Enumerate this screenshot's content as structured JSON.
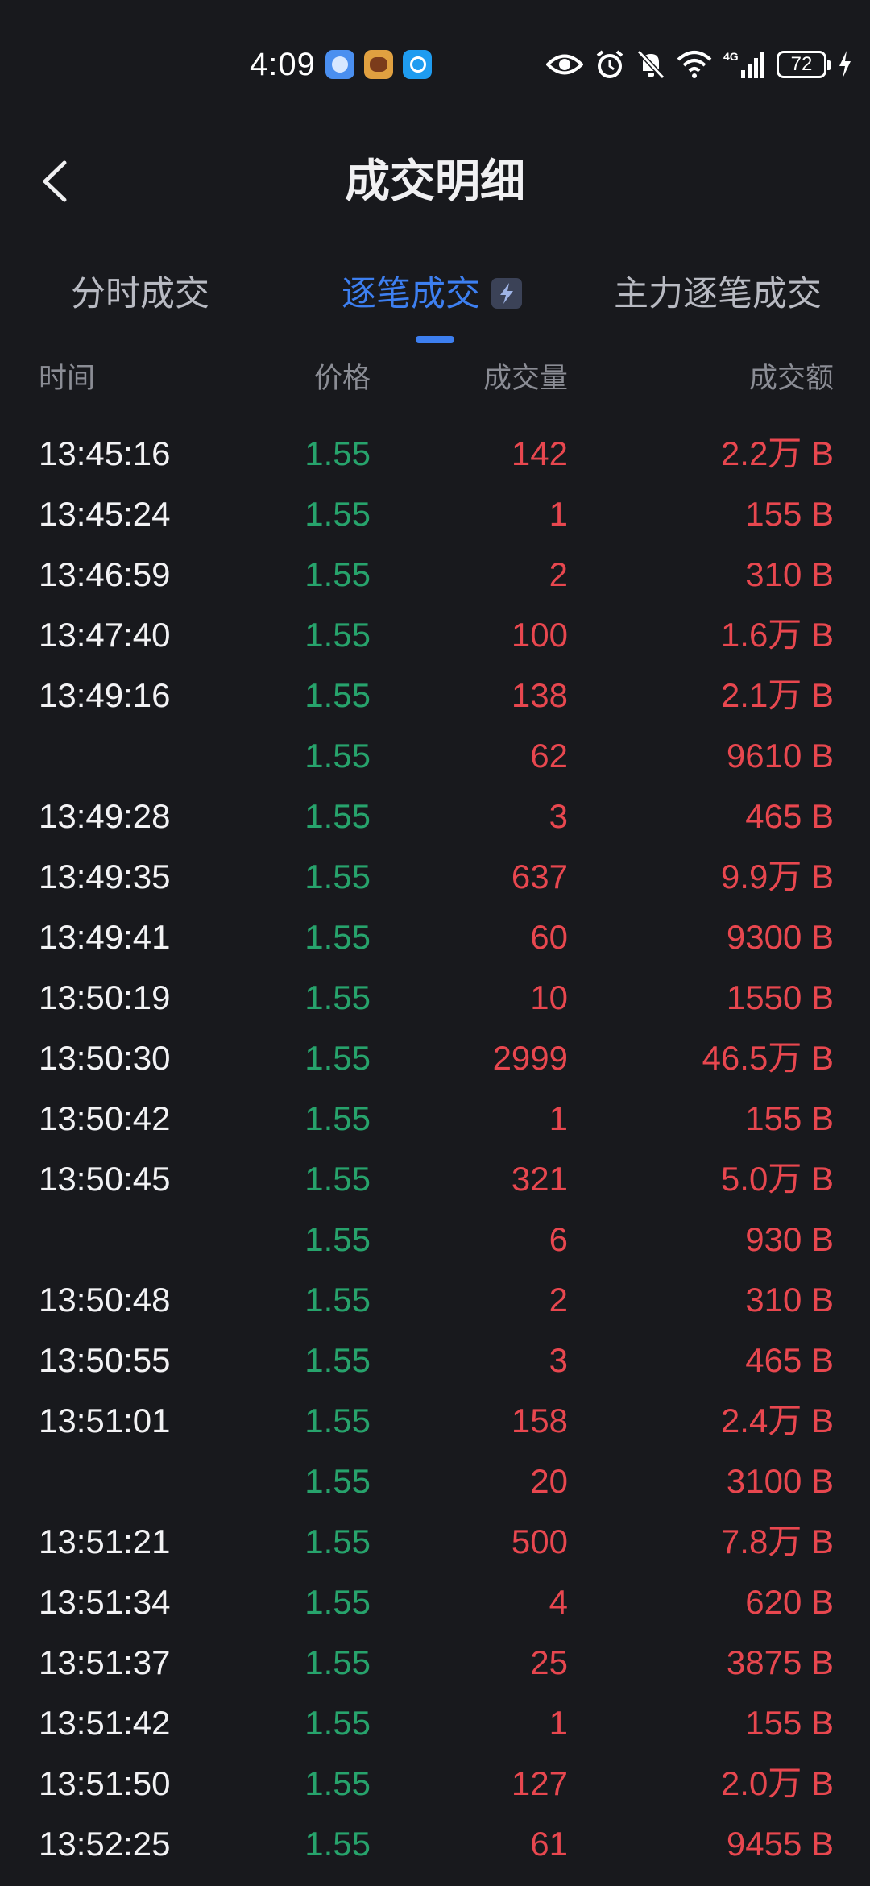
{
  "status_bar": {
    "time": "4:09",
    "battery": "72",
    "network": "4G"
  },
  "header": {
    "title": "成交明细"
  },
  "tabs": [
    {
      "label": "分时成交"
    },
    {
      "label": "逐笔成交"
    },
    {
      "label": "主力逐笔成交"
    }
  ],
  "active_tab": "逐笔成交",
  "columns": {
    "time": "时间",
    "price": "价格",
    "volume": "成交量",
    "amount": "成交额"
  },
  "trades": [
    {
      "time": "13:45:16",
      "price": "1.55",
      "volume": "142",
      "amount": "2.2万 B"
    },
    {
      "time": "13:45:24",
      "price": "1.55",
      "volume": "1",
      "amount": "155 B"
    },
    {
      "time": "13:46:59",
      "price": "1.55",
      "volume": "2",
      "amount": "310 B"
    },
    {
      "time": "13:47:40",
      "price": "1.55",
      "volume": "100",
      "amount": "1.6万 B"
    },
    {
      "time": "13:49:16",
      "price": "1.55",
      "volume": "138",
      "amount": "2.1万 B"
    },
    {
      "time": "",
      "price": "1.55",
      "volume": "62",
      "amount": "9610 B"
    },
    {
      "time": "13:49:28",
      "price": "1.55",
      "volume": "3",
      "amount": "465 B"
    },
    {
      "time": "13:49:35",
      "price": "1.55",
      "volume": "637",
      "amount": "9.9万 B"
    },
    {
      "time": "13:49:41",
      "price": "1.55",
      "volume": "60",
      "amount": "9300 B"
    },
    {
      "time": "13:50:19",
      "price": "1.55",
      "volume": "10",
      "amount": "1550 B"
    },
    {
      "time": "13:50:30",
      "price": "1.55",
      "volume": "2999",
      "amount": "46.5万 B"
    },
    {
      "time": "13:50:42",
      "price": "1.55",
      "volume": "1",
      "amount": "155 B"
    },
    {
      "time": "13:50:45",
      "price": "1.55",
      "volume": "321",
      "amount": "5.0万 B"
    },
    {
      "time": "",
      "price": "1.55",
      "volume": "6",
      "amount": "930 B"
    },
    {
      "time": "13:50:48",
      "price": "1.55",
      "volume": "2",
      "amount": "310 B"
    },
    {
      "time": "13:50:55",
      "price": "1.55",
      "volume": "3",
      "amount": "465 B"
    },
    {
      "time": "13:51:01",
      "price": "1.55",
      "volume": "158",
      "amount": "2.4万 B"
    },
    {
      "time": "",
      "price": "1.55",
      "volume": "20",
      "amount": "3100 B"
    },
    {
      "time": "13:51:21",
      "price": "1.55",
      "volume": "500",
      "amount": "7.8万 B"
    },
    {
      "time": "13:51:34",
      "price": "1.55",
      "volume": "4",
      "amount": "620 B"
    },
    {
      "time": "13:51:37",
      "price": "1.55",
      "volume": "25",
      "amount": "3875 B"
    },
    {
      "time": "13:51:42",
      "price": "1.55",
      "volume": "1",
      "amount": "155 B"
    },
    {
      "time": "13:51:50",
      "price": "1.55",
      "volume": "127",
      "amount": "2.0万 B"
    },
    {
      "time": "13:52:25",
      "price": "1.55",
      "volume": "61",
      "amount": "9455 B"
    }
  ],
  "colors": {
    "background": "#18191d",
    "accent": "#3d7ff0",
    "price_green": "#27a36c",
    "volume_red": "#e8474f"
  },
  "icons": {
    "back": "chevron-left-icon",
    "tab_badge": "lightning-icon"
  }
}
